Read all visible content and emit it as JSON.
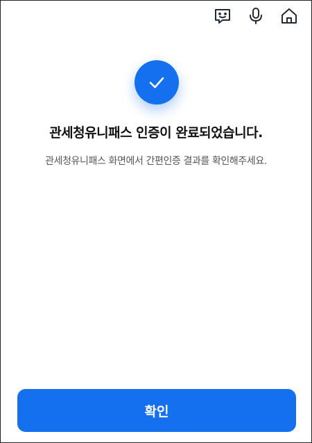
{
  "header": {
    "icons": [
      "chat-icon",
      "microphone-icon",
      "home-icon"
    ]
  },
  "status": {
    "icon": "check-icon",
    "title": "관세청유니패스 인증이 완료되었습니다.",
    "subtitle": "관세청유니패스 화면에서 간편인증 결과를 확인해주세요."
  },
  "footer": {
    "confirm_label": "확인"
  },
  "colors": {
    "accent": "#1570EF",
    "icon_dark": "#1F2A37",
    "title": "#111111",
    "subtitle": "#555555"
  }
}
